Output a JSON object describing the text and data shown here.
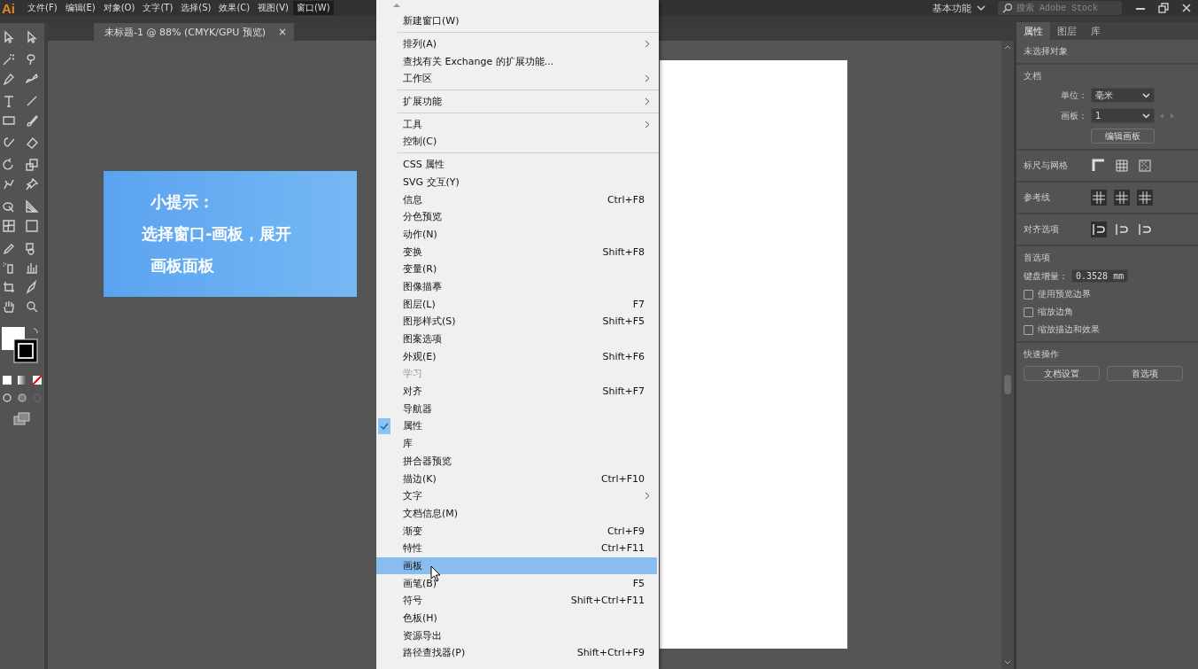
{
  "app_menu": [
    {
      "label": "文件(F)",
      "selected": false
    },
    {
      "label": "编辑(E)",
      "selected": false
    },
    {
      "label": "对象(O)",
      "selected": false
    },
    {
      "label": "文字(T)",
      "selected": false
    },
    {
      "label": "选择(S)",
      "selected": false
    },
    {
      "label": "效果(C)",
      "selected": false
    },
    {
      "label": "视图(V)",
      "selected": false
    },
    {
      "label": "窗口(W)",
      "selected": true
    }
  ],
  "logo": "Ai",
  "workspace": "基本功能",
  "search": {
    "placeholder": "搜索 Adobe Stock"
  },
  "document_tab": {
    "title": "未标题-1 @ 88% (CMYK/GPU 预览)",
    "close": "×"
  },
  "tip": {
    "lines": [
      "小提示：",
      "选择窗口-画板，展开",
      "画板面板"
    ]
  },
  "window_menu": {
    "groups": [
      [
        {
          "label": "新建窗口(W)",
          "submenu": false,
          "checked": false,
          "disabled": false,
          "selected": false
        }
      ],
      [
        {
          "label": "排列(A)",
          "submenu": true,
          "checked": false,
          "disabled": false,
          "selected": false
        },
        {
          "label": "查找有关 Exchange 的扩展功能...",
          "submenu": false,
          "checked": false,
          "disabled": false,
          "selected": false
        },
        {
          "label": "工作区",
          "submenu": true,
          "checked": false,
          "disabled": false,
          "selected": false
        }
      ],
      [
        {
          "label": "扩展功能",
          "submenu": true,
          "checked": false,
          "disabled": false,
          "selected": false
        }
      ],
      [
        {
          "label": "工具",
          "submenu": true,
          "checked": false,
          "disabled": false,
          "selected": false
        },
        {
          "label": "控制(C)",
          "submenu": false,
          "checked": false,
          "disabled": false,
          "selected": false
        }
      ],
      [
        {
          "label": "CSS 属性",
          "submenu": false,
          "checked": false,
          "disabled": false,
          "selected": false
        },
        {
          "label": "SVG 交互(Y)",
          "submenu": false,
          "checked": false,
          "disabled": false,
          "selected": false
        },
        {
          "label": "信息",
          "shortcut": "Ctrl+F8",
          "submenu": false,
          "checked": false,
          "disabled": false,
          "selected": false
        },
        {
          "label": "分色预览",
          "submenu": false,
          "checked": false,
          "disabled": false,
          "selected": false
        },
        {
          "label": "动作(N)",
          "submenu": false,
          "checked": false,
          "disabled": false,
          "selected": false
        },
        {
          "label": "变换",
          "shortcut": "Shift+F8",
          "submenu": false,
          "checked": false,
          "disabled": false,
          "selected": false
        },
        {
          "label": "变量(R)",
          "submenu": false,
          "checked": false,
          "disabled": false,
          "selected": false
        },
        {
          "label": "图像描摹",
          "submenu": false,
          "checked": false,
          "disabled": false,
          "selected": false
        },
        {
          "label": "图层(L)",
          "shortcut": "F7",
          "submenu": false,
          "checked": false,
          "disabled": false,
          "selected": false
        },
        {
          "label": "图形样式(S)",
          "shortcut": "Shift+F5",
          "submenu": false,
          "checked": false,
          "disabled": false,
          "selected": false
        },
        {
          "label": "图案选项",
          "submenu": false,
          "checked": false,
          "disabled": false,
          "selected": false
        },
        {
          "label": "外观(E)",
          "shortcut": "Shift+F6",
          "submenu": false,
          "checked": false,
          "disabled": false,
          "selected": false
        },
        {
          "label": "学习",
          "submenu": false,
          "checked": false,
          "disabled": true,
          "selected": false
        },
        {
          "label": "对齐",
          "shortcut": "Shift+F7",
          "submenu": false,
          "checked": false,
          "disabled": false,
          "selected": false
        },
        {
          "label": "导航器",
          "submenu": false,
          "checked": false,
          "disabled": false,
          "selected": false
        },
        {
          "label": "属性",
          "submenu": false,
          "checked": true,
          "disabled": false,
          "selected": false
        },
        {
          "label": "库",
          "submenu": false,
          "checked": false,
          "disabled": false,
          "selected": false
        },
        {
          "label": "拼合器预览",
          "submenu": false,
          "checked": false,
          "disabled": false,
          "selected": false
        },
        {
          "label": "描边(K)",
          "shortcut": "Ctrl+F10",
          "submenu": false,
          "checked": false,
          "disabled": false,
          "selected": false
        },
        {
          "label": "文字",
          "submenu": true,
          "checked": false,
          "disabled": false,
          "selected": false
        },
        {
          "label": "文档信息(M)",
          "submenu": false,
          "checked": false,
          "disabled": false,
          "selected": false
        },
        {
          "label": "渐变",
          "shortcut": "Ctrl+F9",
          "submenu": false,
          "checked": false,
          "disabled": false,
          "selected": false
        },
        {
          "label": "特性",
          "shortcut": "Ctrl+F11",
          "submenu": false,
          "checked": false,
          "disabled": false,
          "selected": false
        },
        {
          "label": "画板",
          "submenu": false,
          "checked": false,
          "disabled": false,
          "selected": true
        },
        {
          "label": "画笔(B)",
          "shortcut": "F5",
          "submenu": false,
          "checked": false,
          "disabled": false,
          "selected": false
        },
        {
          "label": "符号",
          "shortcut": "Shift+Ctrl+F11",
          "submenu": false,
          "checked": false,
          "disabled": false,
          "selected": false
        },
        {
          "label": "色板(H)",
          "submenu": false,
          "checked": false,
          "disabled": false,
          "selected": false
        },
        {
          "label": "资源导出",
          "submenu": false,
          "checked": false,
          "disabled": false,
          "selected": false
        },
        {
          "label": "路径查找器(P)",
          "shortcut": "Shift+Ctrl+F9",
          "submenu": false,
          "checked": false,
          "disabled": false,
          "selected": false
        }
      ]
    ]
  },
  "panel": {
    "tabs": [
      {
        "label": "属性",
        "selected": true
      },
      {
        "label": "图层",
        "selected": false
      },
      {
        "label": "库",
        "selected": false
      }
    ],
    "status": "未选择对象",
    "document": {
      "heading": "文档",
      "unit_label": "单位：",
      "unit_value": "毫米",
      "artboard_label": "画板：",
      "artboard_value": "1",
      "edit_button": "编辑画板"
    },
    "rows": [
      {
        "label": "标尺与网格",
        "kind": "rulers"
      },
      {
        "label": "参考线",
        "kind": "guides"
      },
      {
        "label": "对齐选项",
        "kind": "snap"
      }
    ],
    "preferences": {
      "heading": "首选项",
      "increment_label": "键盘增量：",
      "increment_value": "0.3528 mm",
      "checkboxes": [
        {
          "label": "使用预览边界",
          "checked": false
        },
        {
          "label": "缩放边角",
          "checked": false
        },
        {
          "label": "缩放描边和效果",
          "checked": false
        }
      ]
    },
    "quick_actions": {
      "heading": "快速操作",
      "buttons": [
        "文档设置",
        "首选项"
      ]
    }
  }
}
